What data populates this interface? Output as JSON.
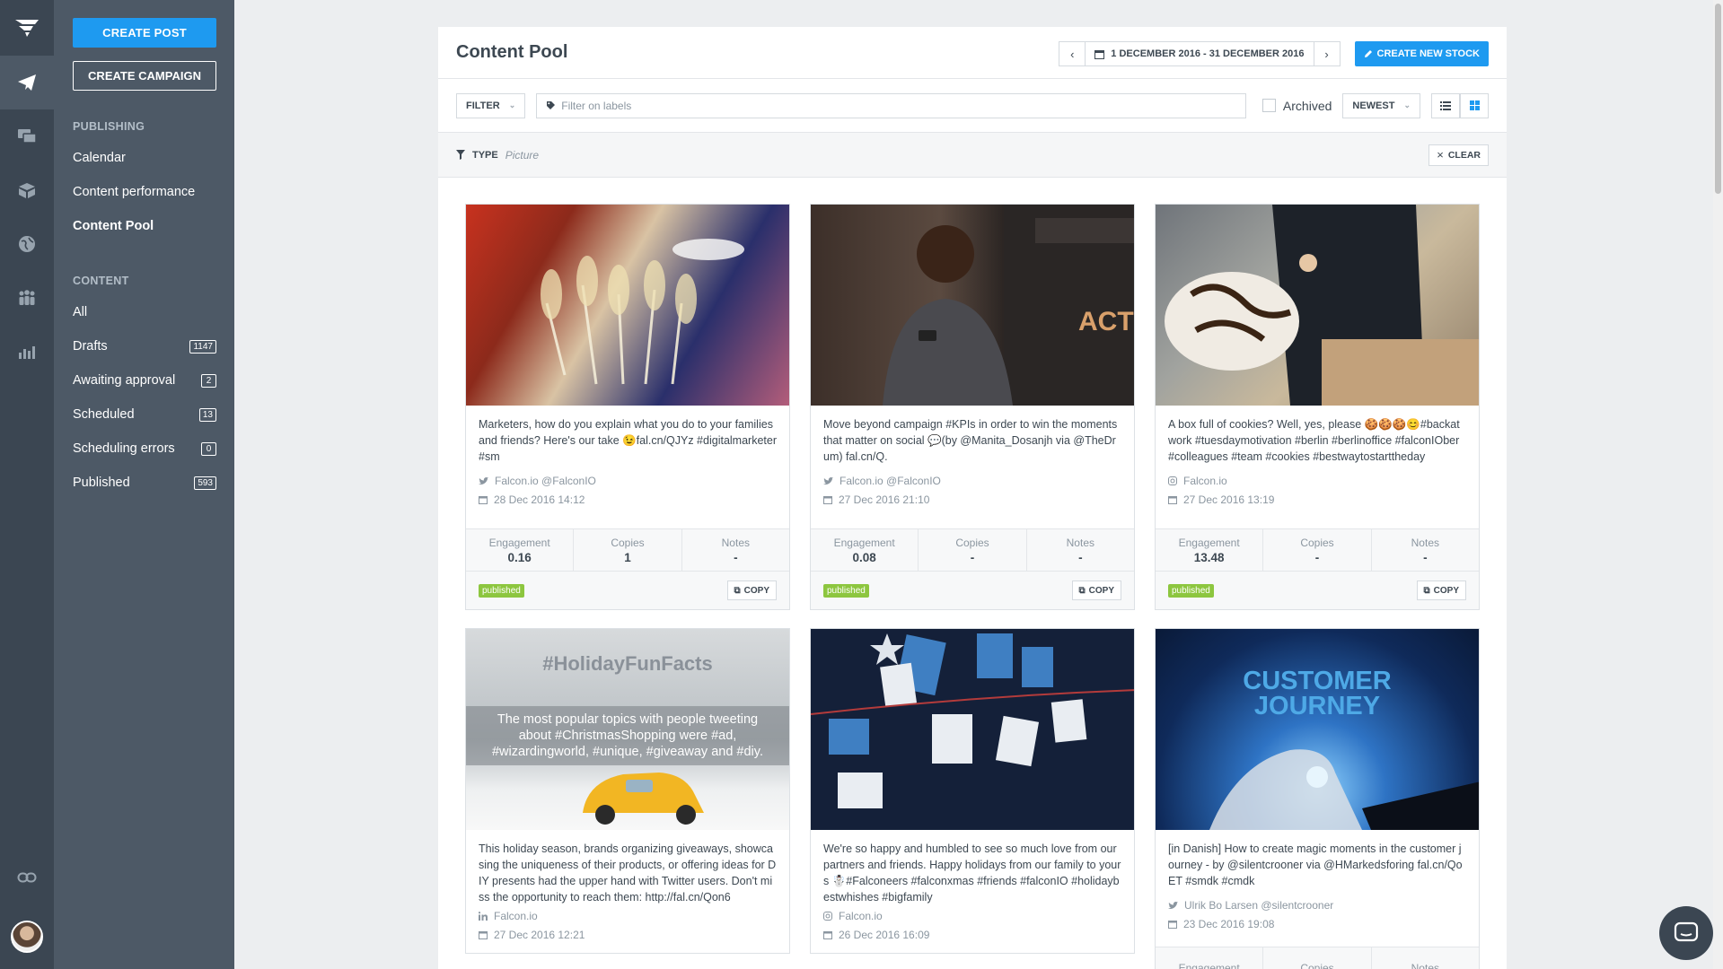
{
  "sidebar": {
    "create_post": "CREATE POST",
    "create_campaign": "CREATE CAMPAIGN",
    "publishing_header": "PUBLISHING",
    "publishing_items": [
      "Calendar",
      "Content performance",
      "Content Pool"
    ],
    "content_header": "CONTENT",
    "content_items": [
      {
        "label": "All",
        "count": ""
      },
      {
        "label": "Drafts",
        "count": "1147"
      },
      {
        "label": "Awaiting approval",
        "count": "2"
      },
      {
        "label": "Scheduled",
        "count": "13"
      },
      {
        "label": "Scheduling errors",
        "count": "0"
      },
      {
        "label": "Published",
        "count": "593"
      }
    ]
  },
  "header": {
    "title": "Content Pool",
    "date_range": "1 DECEMBER 2016 - 31 DECEMBER 2016",
    "create_stock": "CREATE NEW STOCK"
  },
  "filters": {
    "filter_label": "FILTER",
    "labels_placeholder": "Filter on labels",
    "archived_label": "Archived",
    "sort_label": "NEWEST",
    "type_label": "TYPE",
    "type_value": "Picture",
    "clear_label": "CLEAR"
  },
  "stat_labels": {
    "engagement": "Engagement",
    "copies": "Copies",
    "notes": "Notes"
  },
  "copy_label": "COPY",
  "cards": [
    {
      "text": "Marketers, how do you explain what you do to your families and friends? Here's our take 😉fal.cn/QJYz #digitalmarketer #sm",
      "network": "twitter",
      "author": "Falcon.io @FalconIO",
      "date": "28 Dec 2016 14:12",
      "engagement": "0.16",
      "copies": "1",
      "notes": "-",
      "status": "published"
    },
    {
      "text": "Move beyond campaign #KPIs in order to win the moments that matter on social 💬(by @Manita_Dosanjh via @TheDrum) fal.cn/Q.",
      "network": "twitter",
      "author": "Falcon.io @FalconIO",
      "date": "27 Dec 2016 21:10",
      "engagement": "0.08",
      "copies": "-",
      "notes": "-",
      "status": "published"
    },
    {
      "text": "A box full of cookies? Well, yes, please 🍪🍪🍪😊#backatwork #tuesdaymotivation #berlin #berlinoffice #falconIOber #colleagues #team #cookies #bestwaytostarttheday",
      "network": "instagram",
      "author": "Falcon.io",
      "date": "27 Dec 2016 13:19",
      "engagement": "13.48",
      "copies": "-",
      "notes": "-",
      "status": "published"
    },
    {
      "text": "This holiday season, brands organizing giveaways, showcasing the uniqueness of their products, or offering ideas for DIY presents had the upper hand with Twitter users. Don't miss the opportunity to reach them: http://fal.cn/Qon6",
      "network": "linkedin",
      "author": "Falcon.io",
      "date": "27 Dec 2016 12:21",
      "image_heading": "#HolidayFunFacts",
      "image_caption": "The most popular topics with people tweeting about #ChristmasShopping were #ad, #wizardingworld, #unique, #giveaway and #diy."
    },
    {
      "text": "We're so happy and humbled to see so much love from our partners and friends. Happy holidays from our family to yours ☃️#Falconeers #falconxmas #friends #falconIO #holidaybestwhishes #bigfamily",
      "network": "instagram",
      "author": "Falcon.io",
      "date": "26 Dec 2016 16:09"
    },
    {
      "text": "[in Danish] How to create magic moments in the customer journey - by @silentcrooner via @HMarkedsforing fal.cn/QoET #smdk #cmdk",
      "network": "twitter",
      "author": "Ulrik Bo Larsen @silentcrooner",
      "date": "23 Dec 2016 19:08",
      "image_heading": "CUSTOMER JOURNEY",
      "engagement_label": "Engagement",
      "copies_label": "Copies",
      "notes_label": "Notes"
    }
  ],
  "colors": {
    "accent": "#1e9af0",
    "rail": "#3b4652",
    "sidebar": "#4d5966",
    "published": "#8dc63f"
  }
}
